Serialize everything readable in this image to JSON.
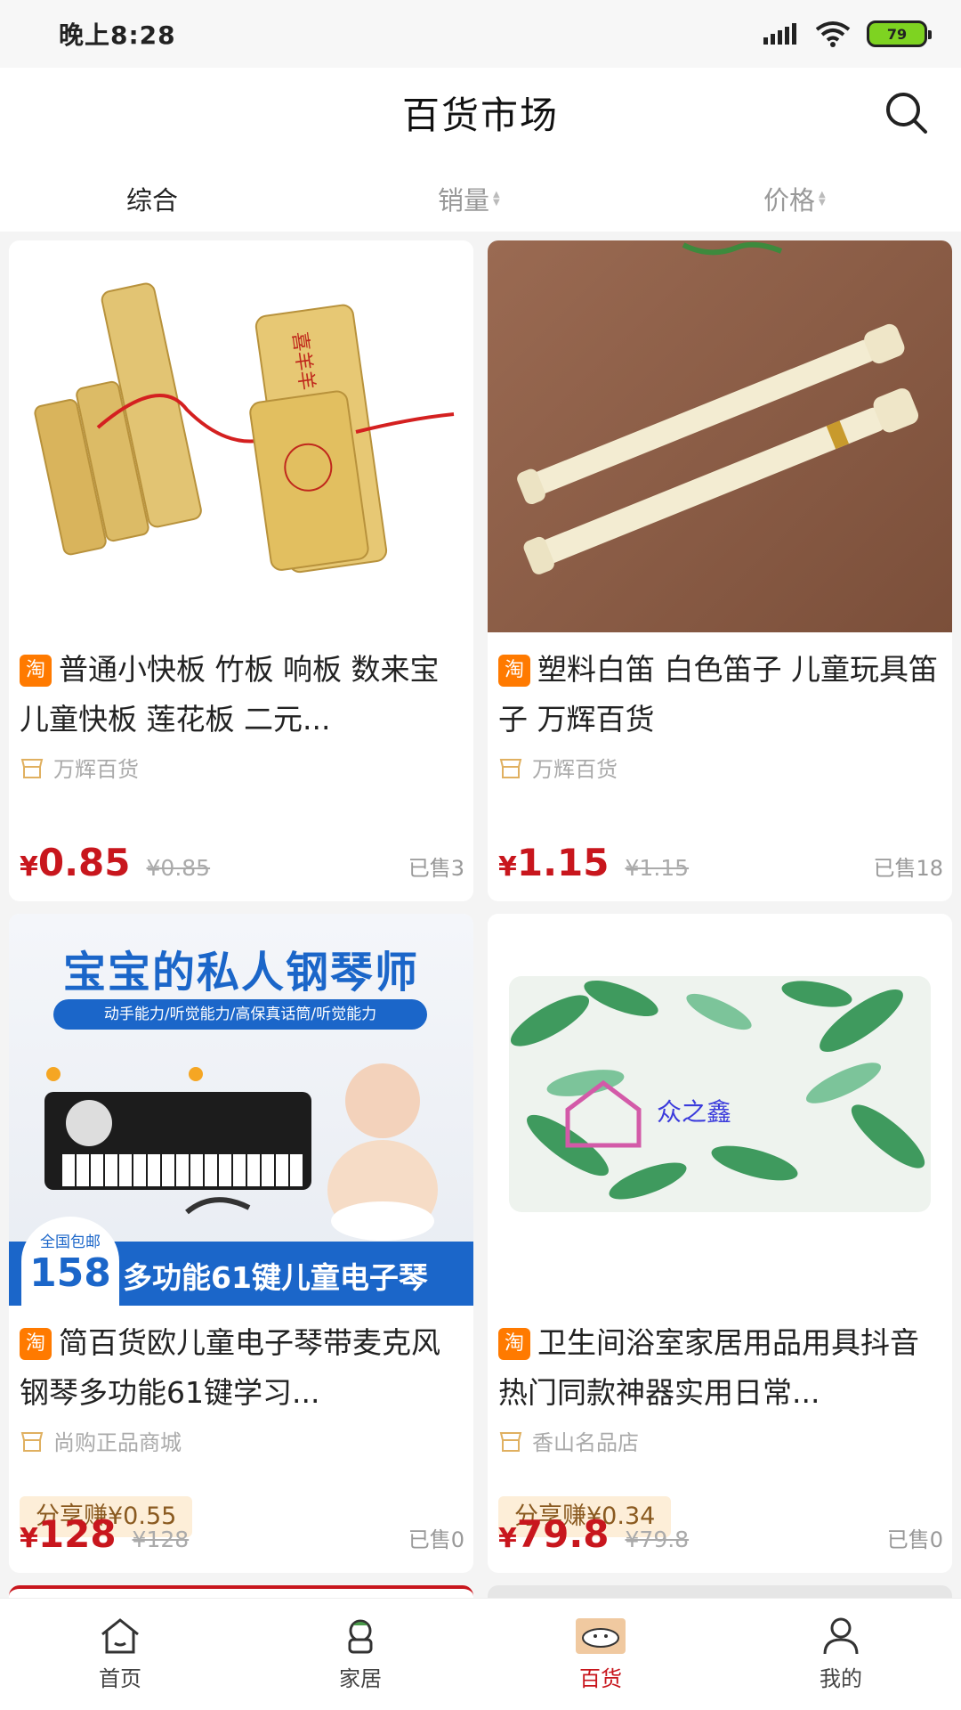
{
  "status_bar": {
    "time": "晚上8:28",
    "battery": "79"
  },
  "header": {
    "title": "百货市场",
    "search_icon": "search-icon"
  },
  "sort_tabs": [
    {
      "label": "综合",
      "active": true
    },
    {
      "label": "销量",
      "active": false
    },
    {
      "label": "价格",
      "active": false
    }
  ],
  "products": [
    {
      "title": "普通小快板 竹板 响板 数来宝 儿童快板 莲花板 二元...",
      "shop": "万辉百货",
      "yen": "¥",
      "price": "0.85",
      "original_price": "¥0.85",
      "sold": "已售3",
      "image_text": "喜羊羊"
    },
    {
      "title": "塑料白笛 白色笛子 儿童玩具笛子 万辉百货",
      "shop": "万辉百货",
      "yen": "¥",
      "price": "1.15",
      "original_price": "¥1.15",
      "sold": "已售18"
    },
    {
      "title": "简百货欧儿童电子琴带麦克风钢琴多功能61键学习...",
      "shop": "尚购正品商城",
      "share": "分享赚¥0.55",
      "yen": "¥",
      "price": "128",
      "original_price": "¥128",
      "sold": "已售0",
      "image_headline": "宝宝的私人钢琴师",
      "image_subline": "动手能力/听觉能力/高保真话筒/听觉能力",
      "image_badge_top": "全国包邮",
      "image_badge_num": "158",
      "image_banner": "多功能61键儿童电子琴"
    },
    {
      "title": "卫生间浴室家居用品用具抖音热门同款神器实用日常...",
      "shop": "香山名品店",
      "share": "分享赚¥0.34",
      "yen": "¥",
      "price": "79.8",
      "original_price": "¥79.8",
      "sold": "已售0",
      "image_logo": "众之鑫"
    }
  ],
  "tb_badge": "淘",
  "bottom_nav": [
    {
      "label": "首页",
      "icon": "home-icon",
      "active": false
    },
    {
      "label": "家居",
      "icon": "home-goods-icon",
      "active": false
    },
    {
      "label": "百货",
      "icon": "store-icon",
      "active": true
    },
    {
      "label": "我的",
      "icon": "user-icon",
      "active": false
    }
  ],
  "colors": {
    "price_red": "#c8161d",
    "taobao_orange": "#ff7a00",
    "share_bg": "#fdeed8"
  }
}
